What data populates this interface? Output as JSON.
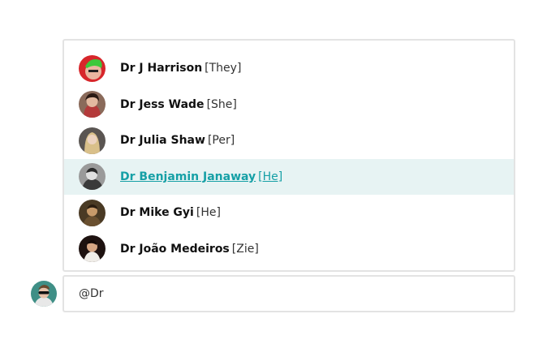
{
  "mentions": {
    "items": [
      {
        "name": "Dr J Harrison",
        "pronoun": "[They]",
        "avatar": "avatar-red-green-hair",
        "active": false
      },
      {
        "name": "Dr Jess Wade",
        "pronoun": "[She]",
        "avatar": "avatar-woman-dark-hair",
        "active": false
      },
      {
        "name": "Dr Julia Shaw",
        "pronoun": "[Per]",
        "avatar": "avatar-blonde-woman",
        "active": false
      },
      {
        "name": "Dr Benjamin Janaway",
        "pronoun": "[He]",
        "avatar": "avatar-man-bw-photo",
        "active": true
      },
      {
        "name": "Dr Mike Gyi",
        "pronoun": "[He]",
        "avatar": "avatar-man-sepia",
        "active": false
      },
      {
        "name": "Dr João Medeiros",
        "pronoun": "[Zie]",
        "avatar": "avatar-man-dark-bg",
        "active": false
      }
    ]
  },
  "composer": {
    "value": "@Dr",
    "avatar": "avatar-user-teal"
  },
  "colors": {
    "accent": "#16a0a6",
    "active_bg": "#e7f3f3",
    "border": "#e3e3e3"
  }
}
